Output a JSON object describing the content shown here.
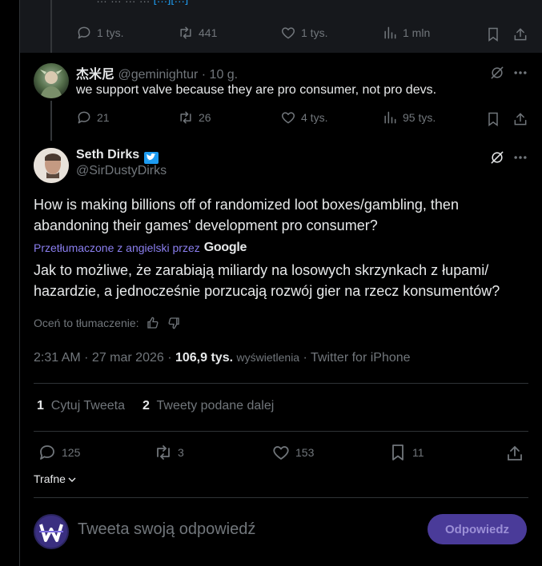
{
  "top_tweet": {
    "cut_text": "… … … …",
    "cut_link": "[…][…]",
    "replies": "1 tys.",
    "retweets": "441",
    "likes": "1 tys.",
    "views": "1 mln"
  },
  "reply_tweet": {
    "name": "杰米尼",
    "handle": "@geminightur",
    "time": "· 10 g.",
    "text": "we support valve because they are pro consumer, not pro devs.",
    "replies": "21",
    "retweets": "26",
    "likes": "4 tys.",
    "views": "95 tys."
  },
  "main_tweet": {
    "name": "Seth Dirks",
    "handle": "@SirDustyDirks",
    "text": "How is making billions off of randomized loot boxes/gambling, then abandoning their games' development pro consumer?",
    "translated_by": "Przetłumaczone z angielski przez",
    "google": "Google",
    "translation": "Jak to możliwe, że zarabiają miliardy na losowych skrzynkach z łupami/ hazardzie, a jednocześnie porzucają rozwój gier na rzecz konsumentów?",
    "rate_translation": "Oceń to tłumaczenie:",
    "time": "2:31 AM · 27 mar 2026 ·",
    "views_count": "106,9 tys.",
    "views_label": "wyświetlenia",
    "source": "· Twitter for iPhone",
    "quote_count": "1",
    "quote_label": "Cytuj Tweeta",
    "retweet_count": "2",
    "retweet_label": "Tweety podane dalej",
    "replies": "125",
    "retweets": "3",
    "likes": "153",
    "bookmarks": "11"
  },
  "sort": {
    "label": "Trafne"
  },
  "composer": {
    "placeholder": "Tweeta swoją odpowiedź",
    "button": "Odpowiedz"
  },
  "colors": {
    "accent": "#1d9bf0",
    "reply_button": "#4a3b99",
    "link": "#8b7ff0"
  }
}
